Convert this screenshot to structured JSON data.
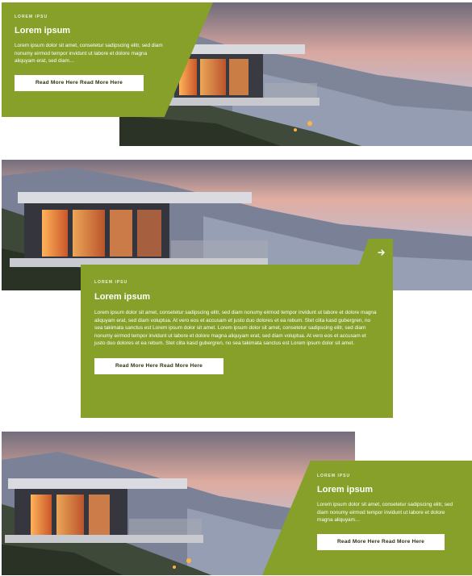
{
  "colors": {
    "accent": "#86a02a",
    "button_bg": "#ffffff",
    "button_text": "#2b3311"
  },
  "icons": {
    "card2_arrow": "arrow-right-icon"
  },
  "cards": [
    {
      "eyebrow": "LOREM IPSU",
      "title": "Lorem ipsum",
      "body": "Lorem ipsum dolor sit amet, consetetur sadipscing elitr, sed diam nonumy eirmod tempor invidunt ut labore et dolore magna aliquyam erat, sed diam…",
      "button_label": "Read More Here Read More Here"
    },
    {
      "eyebrow": "LOREM IPSU",
      "title": "Lorem ipsum",
      "body": "Lorem ipsum dolor sit amet, consetetur sadipscing elitr, sed diam nonumy eirmod tempor invidunt ut labore et dolore magna aliquyam erat, sed diam voluptua. At vero eos et accusam et justo duo dolores et ea rebum. Stet clita kasd gubergren, no sea takimata sanctus est Lorem ipsum dolor sit amet. Lorem ipsum dolor sit amet, consetetur sadipscing elitr, sed diam nonumy eirmod tempor invidunt ut labore et dolore magna aliquyam erat, sed diam voluptua. At vero eos et accusam et justo duo dolores et ea rebum. Stet clita kasd gubergren, no sea takimata sanctus est Lorem ipsum dolor sit amet.",
      "button_label": "Read More Here Read More Here"
    },
    {
      "eyebrow": "LOREM IPSU",
      "title": "Lorem ipsum",
      "body": "Lorem ipsum dolor sit amet, consetetur sadipscing elitr, sed diam nonumy eirmod tempor invidunt ut labore et dolore magna aliquyam…",
      "button_label": "Read More Here Read More Here"
    }
  ]
}
